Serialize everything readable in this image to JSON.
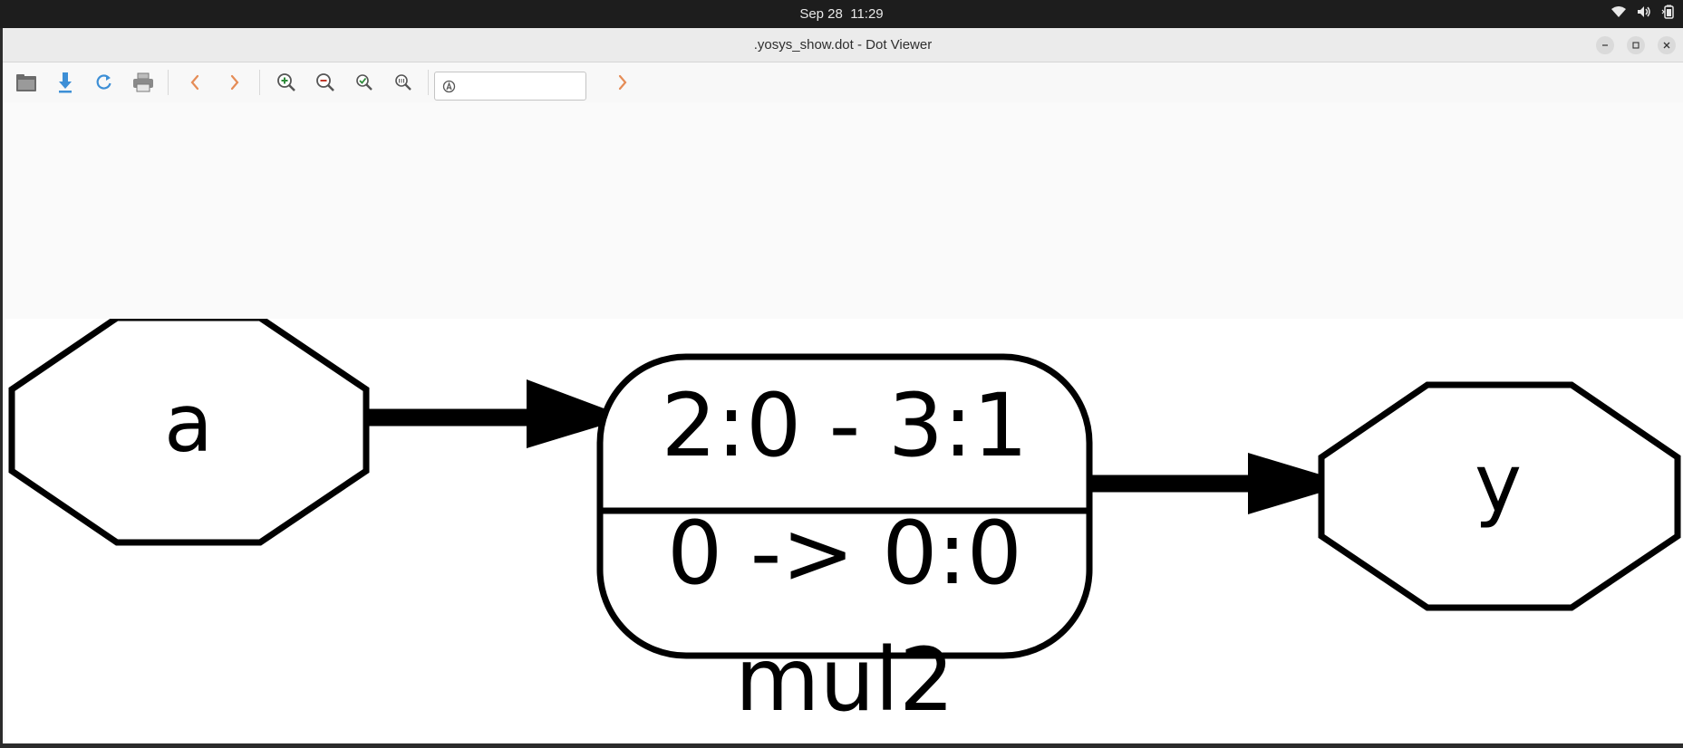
{
  "system_bar": {
    "date": "Sep 28",
    "time": "11:29"
  },
  "window": {
    "title": ".yosys_show.dot - Dot Viewer"
  },
  "toolbar": {
    "buttons": [
      "open-icon",
      "save-icon",
      "reload-icon",
      "print-icon",
      "back-icon",
      "forward-icon",
      "zoom-in-icon",
      "zoom-out-icon",
      "zoom-fit-icon",
      "zoom-100-icon"
    ],
    "search": {
      "value": "",
      "placeholder": ""
    }
  },
  "graph": {
    "nodes": {
      "input_a": "a",
      "cell_top": "2:0 - 3:1",
      "cell_bottom": "0 -> 0:0",
      "cell_name": "mul2",
      "output_y": "y"
    }
  },
  "colors": {
    "toolbar_blue": "#3d8fd6",
    "arrow_orange": "#e58c56",
    "zoom_in_green": "#2e8b3a",
    "zoom_out_red": "#c0392b"
  }
}
